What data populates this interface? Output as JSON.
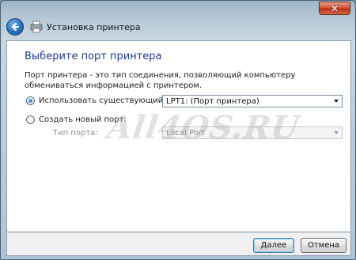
{
  "window": {
    "ghost_title": "",
    "close_glyph": "✕"
  },
  "header": {
    "title": "Установка принтера",
    "back_icon": "back-arrow-icon",
    "printer_icon": "printer-icon"
  },
  "page": {
    "heading": "Выберите порт принтера",
    "description": "Порт принтера - это тип соединения, позволяющий компьютеру обмениваться информацией с принтером."
  },
  "options": {
    "use_existing": {
      "label": "Использовать существующий порт:",
      "checked": true,
      "select_value": "LPT1: (Порт принтера)"
    },
    "create_new": {
      "label": "Создать новый порт:",
      "checked": false,
      "type_label": "Тип порта:",
      "select_value": "Local Port"
    }
  },
  "footer": {
    "next_label": "Далее",
    "cancel_label": "Отмена"
  },
  "watermark": "All4OS.RU",
  "colors": {
    "heading": "#1f3d8c",
    "close_button": "#d4573c",
    "back_button": "#2a6fbf",
    "default_button_border": "#3c7fb1"
  }
}
